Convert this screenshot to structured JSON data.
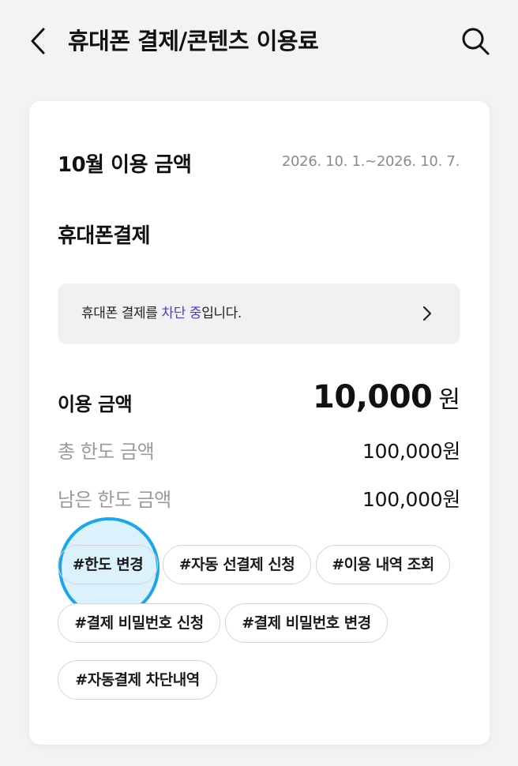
{
  "header": {
    "title": "휴대폰 결제/콘텐츠 이용료",
    "back_icon": "chevron-left-icon",
    "search_icon": "search-icon"
  },
  "card": {
    "month_title": "10월 이용 금액",
    "period": "2026. 10. 1.~2026. 10. 7.",
    "section_title": "휴대폰결제",
    "notice": {
      "prefix": "휴대폰 결제를 ",
      "accent": "차단 중",
      "suffix": "입니다.",
      "accent_color": "#4b3fc5",
      "arrow_icon": "chevron-right-icon"
    },
    "usage": {
      "label": "이용 금액",
      "value": "10,000",
      "unit": "원"
    },
    "total_limit": {
      "label": "총 한도 금액",
      "value": "100,000원"
    },
    "remaining_limit": {
      "label": "남은 한도 금액",
      "value": "100,000원"
    },
    "tags": [
      "#한도 변경",
      "#자동 선결제 신청",
      "#이용 내역 조회",
      "#결제 비밀번호 신청",
      "#결제 비밀번호 변경",
      "#자동결제 차단내역"
    ],
    "highlight_color": "#1aa6ee"
  }
}
